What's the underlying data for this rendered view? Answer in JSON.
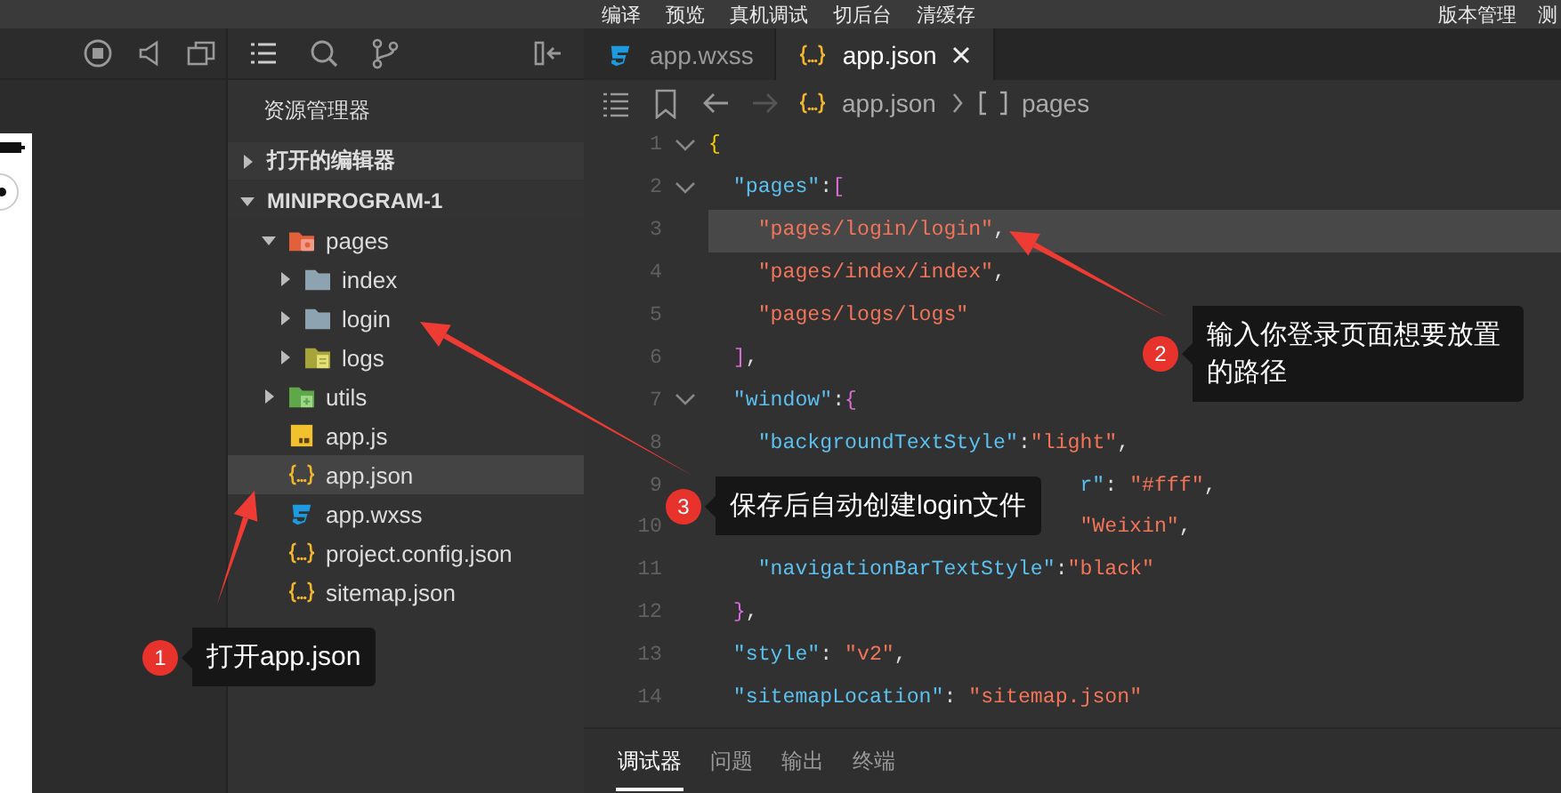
{
  "menu": [
    "编译",
    "预览",
    "真机调试",
    "切后台",
    "清缓存"
  ],
  "menu_right": [
    "版本管理",
    "测"
  ],
  "explorer": {
    "title": "资源管理器",
    "sections": [
      {
        "label": "打开的编辑器",
        "expanded": false
      },
      {
        "label": "MINIPROGRAM-1",
        "expanded": true,
        "children": [
          {
            "label": "pages",
            "kind": "pages-folder",
            "expanded": true,
            "selected": false,
            "children": [
              {
                "label": "index",
                "kind": "folder",
                "expanded": false,
                "selected": false
              },
              {
                "label": "login",
                "kind": "folder",
                "expanded": false,
                "selected": false
              },
              {
                "label": "logs",
                "kind": "logs-folder",
                "expanded": false,
                "selected": false
              }
            ]
          },
          {
            "label": "utils",
            "kind": "utils-folder",
            "expanded": false,
            "selected": false
          },
          {
            "label": "app.js",
            "kind": "js",
            "selected": false
          },
          {
            "label": "app.json",
            "kind": "json",
            "selected": true
          },
          {
            "label": "app.wxss",
            "kind": "wxss",
            "selected": false
          },
          {
            "label": "project.config.json",
            "kind": "json",
            "selected": false
          },
          {
            "label": "sitemap.json",
            "kind": "json",
            "selected": false
          }
        ]
      }
    ]
  },
  "editor": {
    "tabs": [
      {
        "label": "app.wxss",
        "kind": "wxss",
        "selected": false
      },
      {
        "label": "app.json",
        "kind": "json",
        "selected": true
      }
    ],
    "breadcrumb": [
      "app.json",
      "pages"
    ],
    "lines": [
      {
        "number": "1",
        "fold": true,
        "current": false,
        "tokens": [
          {
            "kind": "brace",
            "text": "{"
          }
        ]
      },
      {
        "number": "2",
        "fold": true,
        "current": false,
        "tokens": [
          {
            "kind": "key",
            "text": "  \"pages\""
          },
          {
            "kind": "punct",
            "text": ":"
          },
          {
            "kind": "bracket",
            "text": "["
          }
        ]
      },
      {
        "number": "3",
        "fold": false,
        "current": true,
        "tokens": [
          {
            "kind": "str",
            "text": "    \"pages/login/login\""
          },
          {
            "kind": "punct",
            "text": ","
          }
        ]
      },
      {
        "number": "4",
        "fold": false,
        "current": false,
        "tokens": [
          {
            "kind": "str",
            "text": "    \"pages/index/index\""
          },
          {
            "kind": "punct",
            "text": ","
          }
        ]
      },
      {
        "number": "5",
        "fold": false,
        "current": false,
        "tokens": [
          {
            "kind": "str",
            "text": "    \"pages/logs/logs\""
          }
        ]
      },
      {
        "number": "6",
        "fold": false,
        "current": false,
        "tokens": [
          {
            "kind": "bracket",
            "text": "  ]"
          },
          {
            "kind": "punct",
            "text": ","
          }
        ]
      },
      {
        "number": "7",
        "fold": true,
        "current": false,
        "tokens": [
          {
            "kind": "key",
            "text": "  \"window\""
          },
          {
            "kind": "punct",
            "text": ":"
          },
          {
            "kind": "bracket",
            "text": "{"
          }
        ]
      },
      {
        "number": "8",
        "fold": false,
        "current": false,
        "tokens": [
          {
            "kind": "key",
            "text": "    \"backgroundTextStyle\""
          },
          {
            "kind": "punct",
            "text": ":"
          },
          {
            "kind": "str",
            "text": "\"light\""
          },
          {
            "kind": "punct",
            "text": ","
          }
        ]
      },
      {
        "number": "9",
        "fold": false,
        "current": false,
        "tokens": [
          {
            "kind": "key",
            "text": "                              r\""
          },
          {
            "kind": "punct",
            "text": ": "
          },
          {
            "kind": "str",
            "text": "\"#fff\""
          },
          {
            "kind": "punct",
            "text": ","
          }
        ]
      },
      {
        "number": "10",
        "fold": false,
        "current": false,
        "tokens": [
          {
            "kind": "str",
            "text": "                              \"Weixin\""
          },
          {
            "kind": "punct",
            "text": ","
          }
        ]
      },
      {
        "number": "11",
        "fold": false,
        "current": false,
        "tokens": [
          {
            "kind": "key",
            "text": "    \"navigationBarTextStyle\""
          },
          {
            "kind": "punct",
            "text": ":"
          },
          {
            "kind": "str",
            "text": "\"black\""
          }
        ]
      },
      {
        "number": "12",
        "fold": false,
        "current": false,
        "tokens": [
          {
            "kind": "bracket",
            "text": "  }"
          },
          {
            "kind": "punct",
            "text": ","
          }
        ]
      },
      {
        "number": "13",
        "fold": false,
        "current": false,
        "tokens": [
          {
            "kind": "key",
            "text": "  \"style\""
          },
          {
            "kind": "punct",
            "text": ": "
          },
          {
            "kind": "str",
            "text": "\"v2\""
          },
          {
            "kind": "punct",
            "text": ","
          }
        ]
      },
      {
        "number": "14",
        "fold": false,
        "current": false,
        "tokens": [
          {
            "kind": "key",
            "text": "  \"sitemapLocation\""
          },
          {
            "kind": "punct",
            "text": ": "
          },
          {
            "kind": "str",
            "text": "\"sitemap.json\""
          }
        ]
      }
    ]
  },
  "panel": {
    "tabs": [
      {
        "label": "调试器",
        "selected": true
      },
      {
        "label": "问题",
        "selected": false
      },
      {
        "label": "输出",
        "selected": false
      },
      {
        "label": "终端",
        "selected": false
      }
    ]
  },
  "annotations": [
    {
      "number": "1",
      "text": "打开app.json"
    },
    {
      "number": "2",
      "text": "输入你登录页面想要放置的路径"
    },
    {
      "number": "3",
      "text": "保存后自动创建login文件"
    }
  ]
}
